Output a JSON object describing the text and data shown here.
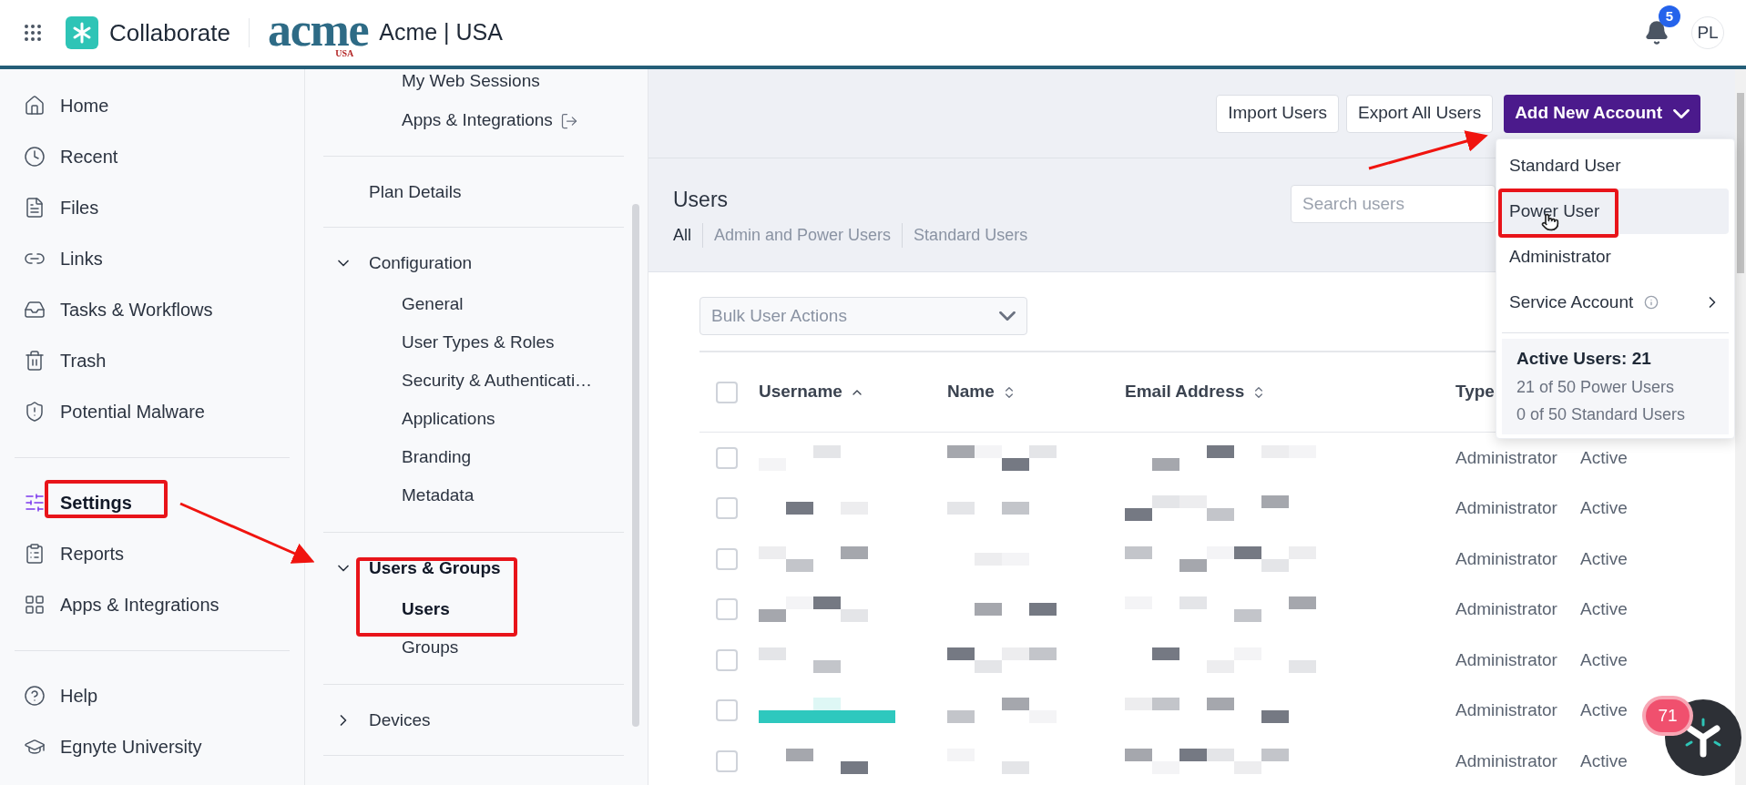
{
  "topbar": {
    "app_name": "Collaborate",
    "brand_logo": "acme",
    "brand_logo_sub": "USA",
    "org": "Acme | USA",
    "notifications": "5",
    "avatar": "PL"
  },
  "sidebar": {
    "sections": [
      [
        {
          "label": "Home",
          "selected": false
        },
        {
          "label": "Recent",
          "selected": false
        },
        {
          "label": "Files",
          "selected": false
        },
        {
          "label": "Links",
          "selected": false
        },
        {
          "label": "Tasks & Workflows",
          "selected": false
        },
        {
          "label": "Trash",
          "selected": false
        },
        {
          "label": "Potential Malware",
          "selected": false
        }
      ],
      [
        {
          "label": "Settings",
          "selected": true
        },
        {
          "label": "Reports",
          "selected": false
        },
        {
          "label": "Apps & Integrations",
          "selected": false
        }
      ],
      [
        {
          "label": "Help",
          "selected": false
        },
        {
          "label": "Egnyte University",
          "selected": false
        }
      ]
    ]
  },
  "settings_nav": [
    {
      "kind": "list",
      "children": [
        {
          "label": "My Web Sessions",
          "selected": false,
          "external": false
        },
        {
          "label": "Apps & Integrations",
          "selected": false,
          "external": true
        }
      ]
    },
    {
      "kind": "link",
      "label": "Plan Details"
    },
    {
      "kind": "group",
      "label": "Configuration",
      "expanded": true,
      "active": false,
      "children": [
        {
          "label": "General",
          "selected": false
        },
        {
          "label": "User Types & Roles",
          "selected": false
        },
        {
          "label": "Security & Authenticati…",
          "selected": false
        },
        {
          "label": "Applications",
          "selected": false
        },
        {
          "label": "Branding",
          "selected": false
        },
        {
          "label": "Metadata",
          "selected": false
        }
      ]
    },
    {
      "kind": "group",
      "label": "Users & Groups",
      "expanded": true,
      "active": true,
      "children": [
        {
          "label": "Users",
          "selected": true
        },
        {
          "label": "Groups",
          "selected": false
        }
      ]
    },
    {
      "kind": "group",
      "label": "Devices",
      "expanded": false,
      "active": false
    }
  ],
  "toolbar": {
    "buttons": [
      "Import Users",
      "Export All Users"
    ],
    "primary": "Add New Account"
  },
  "users_panel": {
    "title": "Users",
    "filters": [
      {
        "label": "All",
        "selected": true
      },
      {
        "label": "Admin and Power Users",
        "selected": false
      },
      {
        "label": "Standard Users",
        "selected": false
      }
    ],
    "search": {
      "placeholder": "Search users"
    }
  },
  "bulk_actions": {
    "placeholder": "Bulk User Actions"
  },
  "table": {
    "select_all_checked": false,
    "columns": [
      {
        "label": "Username",
        "sorted": true,
        "sortable": true
      },
      {
        "label": "Name",
        "sorted": false,
        "sortable": true
      },
      {
        "label": "Email Address",
        "sorted": false,
        "sortable": true
      },
      {
        "label": "Type"
      }
    ],
    "rows": [
      {
        "checked": false,
        "type": "Administrator",
        "status": "Active"
      },
      {
        "checked": false,
        "type": "Administrator",
        "status": "Active"
      },
      {
        "checked": false,
        "type": "Administrator",
        "status": "Active"
      },
      {
        "checked": false,
        "type": "Administrator",
        "status": "Active"
      },
      {
        "checked": false,
        "type": "Administrator",
        "status": "Active"
      },
      {
        "checked": false,
        "type": "Administrator",
        "status": "Active"
      },
      {
        "checked": false,
        "type": "Administrator",
        "status": "Active"
      }
    ]
  },
  "dropdown": {
    "items": [
      {
        "label": "Standard User",
        "selected": false,
        "info": false,
        "submenu": false
      },
      {
        "label": "Power User",
        "selected": true,
        "info": false,
        "submenu": false
      },
      {
        "label": "Administrator",
        "selected": false,
        "info": false,
        "submenu": false
      },
      {
        "label": "Service Account",
        "selected": false,
        "info": true,
        "submenu": true
      }
    ],
    "summary": {
      "title": "Active Users: 21",
      "lines": [
        "21 of 50 Power Users",
        "0 of 50 Standard Users"
      ]
    }
  },
  "chat_widget": {
    "badge": "71"
  }
}
